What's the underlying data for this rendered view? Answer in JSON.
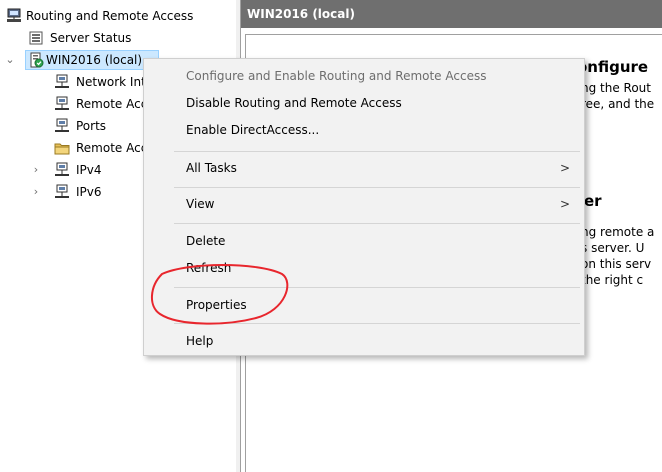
{
  "tree": {
    "root_label": "Routing and Remote Access",
    "items": [
      {
        "label": "Server Status"
      },
      {
        "label": "WIN2016 (local)"
      },
      {
        "label": "Network Interfaces"
      },
      {
        "label": "Remote Access Clients"
      },
      {
        "label": "Ports"
      },
      {
        "label": "Remote Access Logging"
      },
      {
        "label": "IPv4"
      },
      {
        "label": "IPv6"
      }
    ]
  },
  "right_pane": {
    "header": "WIN2016 (local)",
    "heading1_visible": "onfigure",
    "line1": "ng the Rout",
    "line2": "ree, and the",
    "heading2_visible": "er",
    "line3": "ng remote a",
    "line4": "s server. U",
    "line5": "on this serv",
    "line6": "the right c"
  },
  "context_menu": {
    "items": [
      {
        "label": "Configure and Enable Routing and Remote Access"
      },
      {
        "label": "Disable Routing and Remote Access"
      },
      {
        "label": "Enable DirectAccess..."
      },
      {
        "label": "All Tasks"
      },
      {
        "label": "View"
      },
      {
        "label": "Delete"
      },
      {
        "label": "Refresh"
      },
      {
        "label": "Properties"
      },
      {
        "label": "Help"
      }
    ],
    "submenu_arrow": ">"
  },
  "colors": {
    "header_bg": "#6f6f6f",
    "menu_bg": "#f2f2f2",
    "selection_bg": "#cce8ff",
    "annotation_red": "#e8262d"
  },
  "icons": {
    "root": "routing-console-icon",
    "server_status": "server-status-icon",
    "server": "server-icon",
    "network": "network-icon",
    "folder": "folder-icon",
    "expand": "chevron-right-icon",
    "collapse": "chevron-down-icon"
  }
}
